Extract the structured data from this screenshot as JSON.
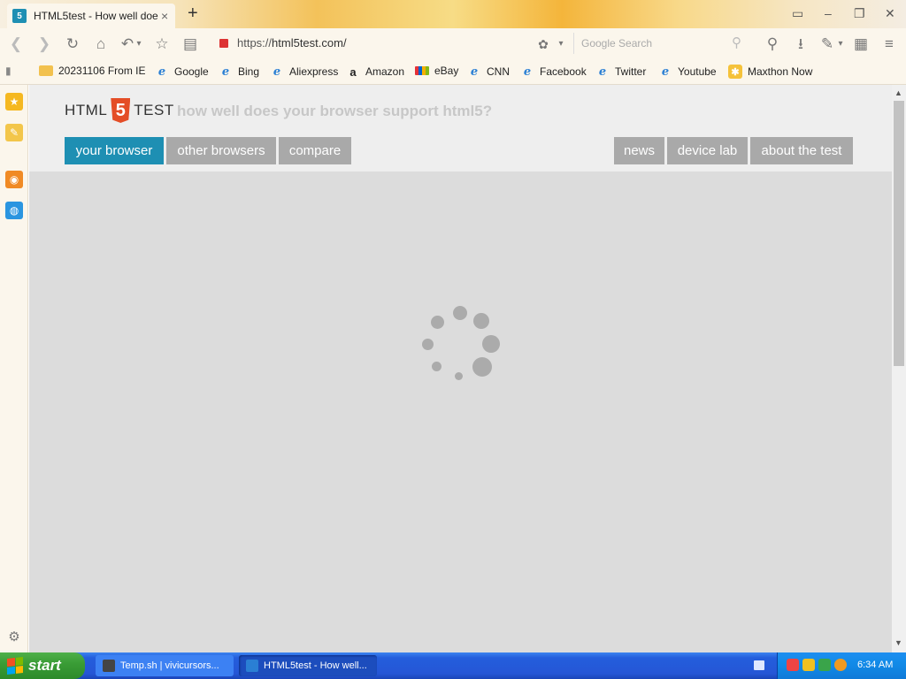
{
  "tab": {
    "title": "HTML5test - How well doe",
    "favicon": "5",
    "close": "×"
  },
  "newtab": "+",
  "window": {
    "layout_icon": "▭",
    "minimize": "–",
    "restore": "❐",
    "close": "✕"
  },
  "nav": {
    "back": "❮",
    "forward": "❯",
    "reload": "↻",
    "home": "⌂",
    "undo": "↶",
    "undo_menu": "▾",
    "favorite": "☆",
    "reader": "▤",
    "address_scheme": "https://",
    "address_host": "html5test.com/",
    "mode": "✿",
    "mode_menu": "▾",
    "search_placeholder": "Google Search",
    "search_icon": "⚲",
    "tools": [
      "⚲",
      "⭳",
      "✎",
      "▾",
      "▦",
      "≡"
    ]
  },
  "bookmarks": {
    "sidebar_toggle": "▮",
    "items": [
      {
        "label": "20231106 From IE",
        "icon": "folder-icon"
      },
      {
        "label": "Google",
        "icon": "ie-icon"
      },
      {
        "label": "Bing",
        "icon": "ie-icon"
      },
      {
        "label": "Aliexpress",
        "icon": "ie-icon"
      },
      {
        "label": "Amazon",
        "icon": "amazon-icon"
      },
      {
        "label": "eBay",
        "icon": "ebay-icon"
      },
      {
        "label": "CNN",
        "icon": "ie-icon"
      },
      {
        "label": "Facebook",
        "icon": "ie-icon"
      },
      {
        "label": "Twitter",
        "icon": "ie-icon"
      },
      {
        "label": "Youtube",
        "icon": "ie-icon"
      },
      {
        "label": "Maxthon Now",
        "icon": "maxthon-icon"
      }
    ]
  },
  "sidebar": {
    "favorites": "★",
    "notes": "✎",
    "rss": "◉",
    "apps": "◍",
    "settings": "⚙"
  },
  "site": {
    "logo_left": "HTML",
    "logo_num": "5",
    "logo_right": "TEST",
    "tagline": "how well does your browser support html5?",
    "nav_left": [
      "your browser",
      "other browsers",
      "compare"
    ],
    "nav_right": [
      "news",
      "device lab",
      "about the test"
    ]
  },
  "scroll": {
    "up": "▲",
    "down": "▼"
  },
  "taskbar": {
    "start": "start",
    "tasks": [
      "Temp.sh | vivicursors...",
      "HTML5test - How well..."
    ],
    "clock": "6:34 AM"
  },
  "colors": {
    "accent": "#1e8fb3",
    "nav_button": "#a9a9a9",
    "page_bg": "#dcdcdc",
    "html5_orange": "#e44d26",
    "taskbar_blue": "#245edc",
    "start_green": "#3a9d36"
  }
}
